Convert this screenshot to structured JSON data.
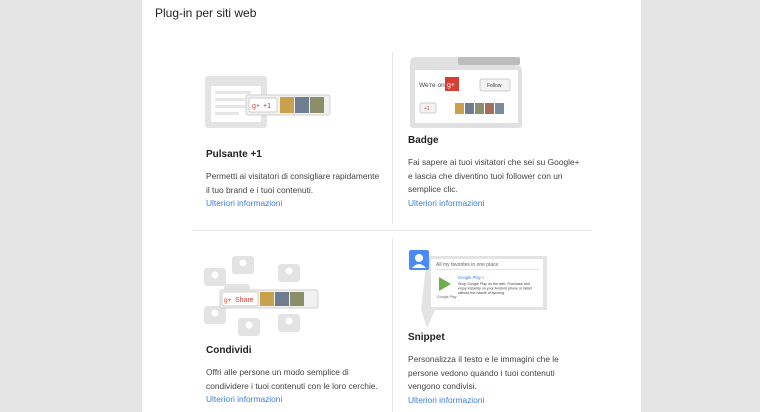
{
  "page_title": "Plug-in per siti web",
  "cards": [
    {
      "title": "Pulsante +1",
      "lines": [
        "Permetti ai visitatori di consigliare rapidamente",
        "il tuo brand e i tuoi contenuti."
      ],
      "link": "Ulteriori informazioni"
    },
    {
      "title": "Badge",
      "lines": [
        "Fai sapere ai tuoi visitatori che sei su Google+",
        "e lascia che diventino tuoi follower con un",
        "semplice clic."
      ],
      "link": "Ulteriori informazioni"
    },
    {
      "title": "Condividi",
      "lines": [
        "Offri alle persone un modo semplice di",
        "condividere i tuoi contenuti con le loro cerchie."
      ],
      "link": "Ulteriori informazioni"
    },
    {
      "title": "Snippet",
      "lines": [
        "Personalizza il testo e le immagini che le",
        "persone vedono quando i tuoi contenuti",
        "vengono condivisi."
      ],
      "link": "Ulteriori informazioni"
    }
  ],
  "illustrations": {
    "plusone_label": "+1",
    "badge_were_on": "We're on",
    "badge_follow": "Follow",
    "badge_plusone": "+1",
    "share_label": "Share",
    "snippet_header": "All my favorites in one place",
    "snippet_app_title": "Google Play »",
    "snippet_desc_1": "Shop Google Play on the web. Purchase and",
    "snippet_desc_2": "enjoy instantly on your Android phone or tablet",
    "snippet_desc_3": "without the hassle of syncing.",
    "snippet_app_caption": "Google Play",
    "gplus_glyph": "g+"
  },
  "colors": {
    "link": "#3f7dd6",
    "gplus_red": "#d73d32",
    "gray_shape": "#e0e0e0",
    "blue_avatar": "#4a8af4"
  }
}
